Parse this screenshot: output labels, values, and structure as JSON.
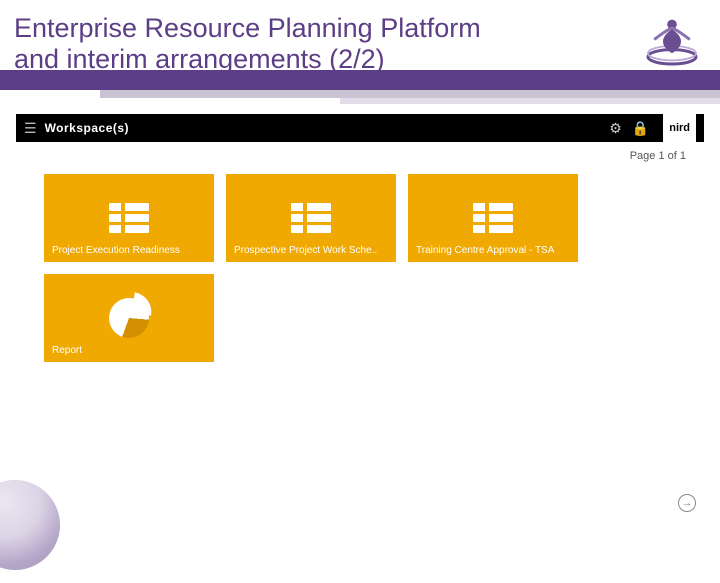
{
  "slide": {
    "title": "Enterprise Resource Planning Platform and interim arrangements (2/2)"
  },
  "erp": {
    "workspace_label": "Workspace(s)",
    "user": "nird",
    "page_indicator": "Page 1 of 1",
    "tiles": [
      {
        "label": "Project Execution Readiness",
        "icon": "list"
      },
      {
        "label": "Prospective Project Work Sche..",
        "icon": "list"
      },
      {
        "label": "Training Centre Approval - TSA",
        "icon": "list"
      },
      {
        "label": "Report",
        "icon": "pie"
      }
    ]
  }
}
